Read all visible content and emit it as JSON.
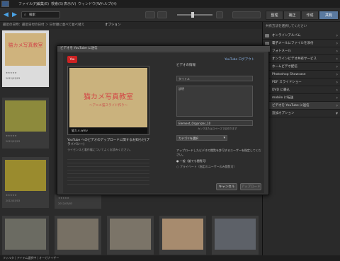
{
  "menu": [
    "ファイル(F)",
    "編集(E)",
    "検索(S)",
    "表示(V)",
    "ウィンドウ(W)",
    "ヘルプ(H)"
  ],
  "search": {
    "label": "検索"
  },
  "modes": [
    "整理",
    "補正",
    "作成",
    "共有"
  ],
  "subbar": {
    "text": "最近の日時：最近日付の日付 ＞ 日付順に並べて並べ替え",
    "option": "オプション"
  },
  "thumbs": [
    {
      "stars": "★★★★★",
      "date": "2012/03/03"
    },
    {
      "stars": "★★★★★",
      "date": "2012/03/03"
    },
    {
      "stars": "★★★★★",
      "date": "2012/03/03"
    },
    {
      "stars": "★★★★★",
      "date": "2012/03/03"
    }
  ],
  "right_panel": {
    "header": "共有方法を選択してください",
    "items": [
      "オンラインアルバム",
      "電子メールにファイルを添付",
      "フォトメール",
      "オンラインビデオ共有サービス",
      "ホームビデオ配信",
      "Photoshop Showcase",
      "PDF スライドショー",
      "DVD に書込",
      "mobile に転送",
      "ビデオを YouTube に送信"
    ],
    "more": "追加オプション"
  },
  "dialog": {
    "title": "ビデオを YouTube に送信",
    "user": "YouTube ログアウト",
    "preview_title": "猫カメ写真教室",
    "preview_subtitle": "〜アニメ猫スライド作り〜",
    "preview_file": "猫カメ.wmv",
    "desc1": "YouTube へのビデオのアップロードに関するお知らせ(プライバシー)",
    "desc2": "ライセンスと著作権についてよくお読みください。",
    "info_header": "ビデオの情報",
    "title_label": "タイトル",
    "desc_label": "説明",
    "tags_value": "Element_Organizer_10",
    "tags_hint": "カンマまたはスペースで区切ります",
    "category": "カテゴリを選択",
    "privacy_text": "アップロードしたビデオの閲覧を許可するユーザーを指定してください。",
    "radio_public": "一般（誰でも閲覧可）",
    "radio_private": "プライベート（指定のユーザーのみ閲覧可）",
    "cancel": "キャンセル",
    "upload": "アップロード"
  },
  "status": {
    "text": "フィルタ | アイテム選択中 | オーガナイザー"
  }
}
